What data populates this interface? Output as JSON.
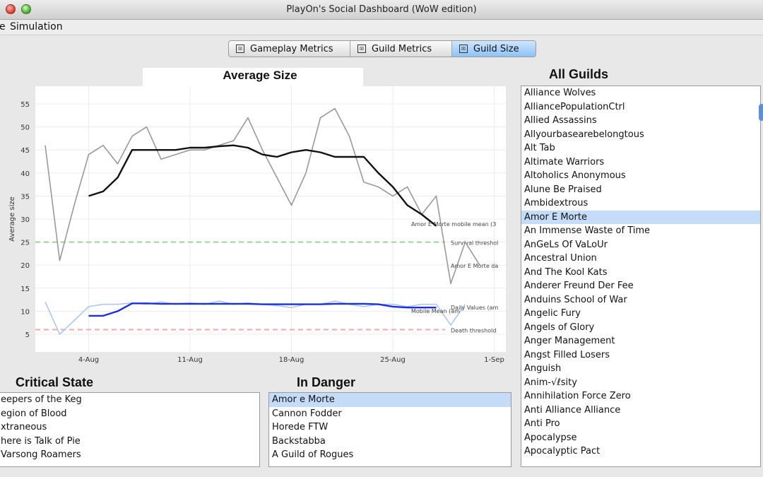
{
  "window": {
    "title": "PlayOn's Social Dashboard (WoW edition)"
  },
  "menu": {
    "items": [
      "e",
      "Simulation"
    ]
  },
  "tabs": [
    {
      "label": "Gameplay Metrics",
      "checked": "☒",
      "active": false
    },
    {
      "label": "Guild Metrics",
      "checked": "☒",
      "active": false
    },
    {
      "label": "Guild Size",
      "checked": "☒",
      "active": true
    }
  ],
  "chart_data": {
    "type": "line",
    "title": "Average Size",
    "ylabel": "Average size",
    "xlabel": "",
    "ylim": [
      3,
      57
    ],
    "xlim": [
      0,
      31
    ],
    "y_ticks": [
      5,
      10,
      15,
      20,
      25,
      30,
      35,
      40,
      45,
      50,
      55
    ],
    "x_ticks": [
      {
        "label": "4-Aug",
        "x": 4
      },
      {
        "label": "11-Aug",
        "x": 11
      },
      {
        "label": "18-Aug",
        "x": 18
      },
      {
        "label": "25-Aug",
        "x": 25
      },
      {
        "label": "1-Sep",
        "x": 32
      }
    ],
    "grid": true,
    "series": [
      {
        "name": "Amor E Morte daily",
        "color": "#999999",
        "stroke_width": 1.6,
        "x": [
          1,
          2,
          3,
          4,
          5,
          6,
          7,
          8,
          9,
          10,
          11,
          12,
          13,
          14,
          15,
          16,
          17,
          18,
          19,
          20,
          21,
          22,
          23,
          24,
          25,
          26,
          27,
          28,
          29,
          30,
          31,
          32
        ],
        "y": [
          46,
          21,
          33,
          44,
          46,
          42,
          48,
          50,
          43,
          44,
          45,
          45,
          46,
          47,
          52,
          45,
          39,
          33,
          40,
          52,
          54,
          48,
          38,
          37,
          35,
          37,
          31,
          35,
          16,
          25,
          20,
          null
        ],
        "label": "Amor E Morte da"
      },
      {
        "name": "Amor E Morte mobile mean",
        "color": "#111111",
        "stroke_width": 2.4,
        "x": [
          4,
          5,
          6,
          7,
          8,
          9,
          10,
          11,
          12,
          13,
          14,
          15,
          16,
          17,
          18,
          19,
          20,
          21,
          22,
          23,
          24,
          25,
          26,
          27,
          28
        ],
        "y": [
          35,
          36,
          39,
          45,
          45,
          45,
          45,
          45.5,
          45.5,
          45.8,
          46,
          45.5,
          44,
          43.5,
          44.5,
          45,
          44.5,
          43.5,
          43.5,
          43.5,
          40,
          37,
          33,
          31,
          28.5
        ],
        "label": "Amor E Morte mobile mean (3"
      },
      {
        "name": "Daily Values",
        "color": "#a8c4f5",
        "stroke_width": 1.5,
        "x": [
          1,
          2,
          3,
          4,
          5,
          6,
          7,
          8,
          9,
          10,
          11,
          12,
          13,
          14,
          15,
          16,
          17,
          18,
          19,
          20,
          21,
          22,
          23,
          24,
          25,
          26,
          27,
          28,
          29,
          30
        ],
        "y": [
          12,
          5,
          8,
          11,
          11.5,
          11.5,
          11.8,
          11.5,
          12,
          11.5,
          11.8,
          11.5,
          12.2,
          11.5,
          11.8,
          11.5,
          11.2,
          10.8,
          11.5,
          11.5,
          12.2,
          11.5,
          11,
          11.5,
          11.5,
          11,
          11.5,
          11.5,
          7,
          11.5
        ],
        "label": "Daily Values (am"
      },
      {
        "name": "Mobile Mean",
        "color": "#1b2fe0",
        "stroke_width": 2.4,
        "x": [
          4,
          5,
          6,
          7,
          8,
          9,
          10,
          11,
          12,
          13,
          14,
          15,
          16,
          17,
          18,
          19,
          20,
          21,
          22,
          23,
          24,
          25,
          26,
          27,
          28
        ],
        "y": [
          9,
          9,
          10,
          11.7,
          11.7,
          11.6,
          11.6,
          11.6,
          11.6,
          11.6,
          11.6,
          11.6,
          11.5,
          11.5,
          11.5,
          11.5,
          11.5,
          11.6,
          11.6,
          11.6,
          11.5,
          11,
          10.8,
          10.8,
          10.8
        ],
        "label": "Mobile Mean (am"
      }
    ],
    "thresholds": [
      {
        "name": "Survival threshold",
        "value": 25,
        "color": "#9dd39d",
        "label": "Survival threshol"
      },
      {
        "name": "Death threshold",
        "value": 6,
        "color": "#f0a8a8",
        "label": "Death threshold"
      }
    ]
  },
  "critical_state": {
    "heading": "Critical State",
    "items": [
      "eepers of the Keg",
      "egion of Blood",
      "xtraneous",
      "here is Talk of Pie",
      "Varsong Roamers"
    ]
  },
  "in_danger": {
    "heading": "In Danger",
    "items": [
      "Amor e Morte",
      "Cannon Fodder",
      "Horede FTW",
      "Backstabba",
      "A Guild of Rogues"
    ],
    "selected": 0
  },
  "all_guilds": {
    "heading": "All Guilds",
    "selected": 9,
    "items": [
      "Alliance Wolves",
      "AlliancePopulationCtrl",
      "Allied Assassins",
      "Allyourbasearebelongtous",
      "Alt Tab",
      "Altimate Warriors",
      "Altoholics Anonymous",
      "Alune Be Praised",
      "Ambidextrous",
      "Amor E Morte",
      "An Immense Waste of Time",
      "AnGeLs Of VaLoUr",
      "Ancestral Union",
      "And The Kool Kats",
      "Anderer Freund Der Fee",
      "Anduins School of War",
      "Angelic Fury",
      "Angels of Glory",
      "Anger Management",
      "Angst Filled Losers",
      "Anguish",
      "Anim-√ℓsity",
      "Annihilation Force Zero",
      "Anti Alliance Alliance",
      "Anti Pro",
      "Apocalypse",
      "Apocalyptic Pact"
    ]
  }
}
